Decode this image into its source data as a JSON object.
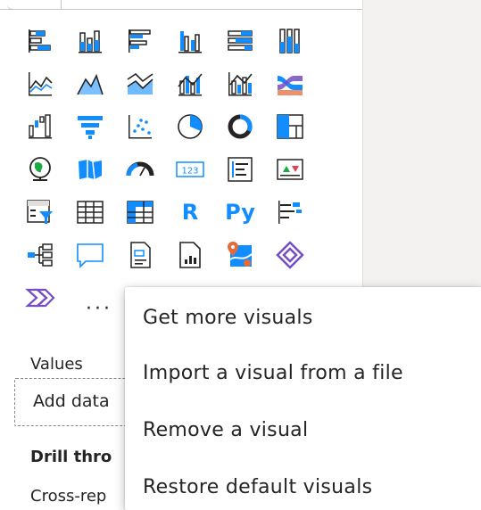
{
  "visuals": {
    "icons": [
      [
        "stacked-bar-chart-icon",
        "stacked-column-chart-icon",
        "clustered-bar-chart-icon",
        "clustered-column-chart-icon",
        "100-stacked-bar-chart-icon",
        "100-stacked-column-chart-icon"
      ],
      [
        "line-chart-icon",
        "area-chart-icon",
        "stacked-area-chart-icon",
        "line-and-stacked-column-chart-icon",
        "line-and-clustered-column-chart-icon",
        "ribbon-chart-icon"
      ],
      [
        "waterfall-chart-icon",
        "funnel-chart-icon",
        "scatter-chart-icon",
        "pie-chart-icon",
        "donut-chart-icon",
        "treemap-icon"
      ],
      [
        "map-icon",
        "filled-map-icon",
        "gauge-icon",
        "card-icon",
        "multi-row-card-icon",
        "kpi-icon"
      ],
      [
        "slicer-icon",
        "table-icon",
        "matrix-icon",
        "r-script-visual-icon",
        "python-visual-icon",
        "key-influencers-icon"
      ],
      [
        "decomposition-tree-icon",
        "qa-icon",
        "smart-narrative-icon",
        "paginated-report-icon",
        "azure-map-icon",
        "power-apps-icon"
      ],
      [
        "power-automate-icon",
        "more-visuals-icon"
      ]
    ],
    "r_label": "R",
    "py_label": "Py",
    "card_label": "123",
    "more_label": "···"
  },
  "fields": {
    "values_label": "Values",
    "add_data_label": "Add data",
    "drill_through_label": "Drill thro",
    "cross_report_label": "Cross-rep"
  },
  "menu": {
    "items": [
      "Get more visuals",
      "Import a visual from a file",
      "Remove a visual",
      "Restore default visuals"
    ]
  },
  "colors": {
    "blue": "#118dff",
    "dark": "#252423",
    "orange": "#e66c37",
    "purple": "#744ec2",
    "green": "#1aab40",
    "red": "#d64550"
  }
}
